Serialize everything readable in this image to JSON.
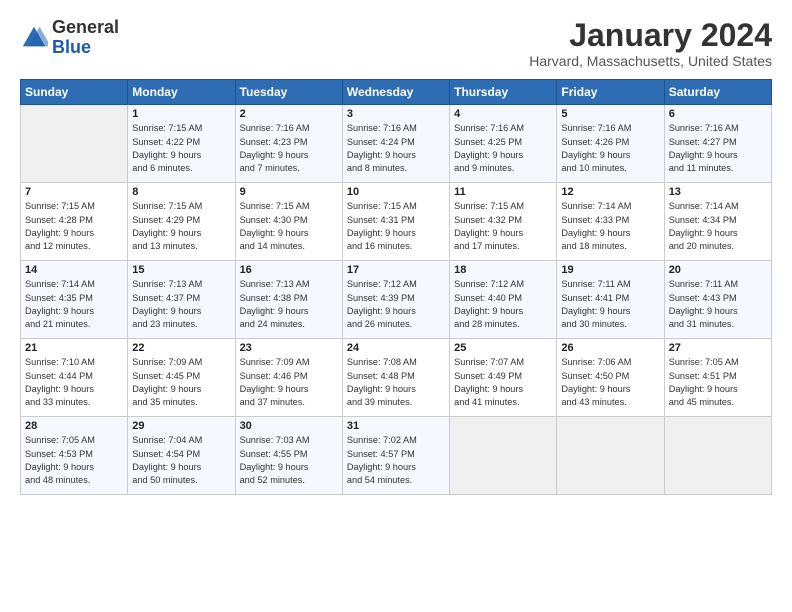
{
  "logo": {
    "line1": "General",
    "line2": "Blue"
  },
  "title": "January 2024",
  "location": "Harvard, Massachusetts, United States",
  "days_header": [
    "Sunday",
    "Monday",
    "Tuesday",
    "Wednesday",
    "Thursday",
    "Friday",
    "Saturday"
  ],
  "weeks": [
    [
      {
        "day": "",
        "info": ""
      },
      {
        "day": "1",
        "info": "Sunrise: 7:15 AM\nSunset: 4:22 PM\nDaylight: 9 hours\nand 6 minutes."
      },
      {
        "day": "2",
        "info": "Sunrise: 7:16 AM\nSunset: 4:23 PM\nDaylight: 9 hours\nand 7 minutes."
      },
      {
        "day": "3",
        "info": "Sunrise: 7:16 AM\nSunset: 4:24 PM\nDaylight: 9 hours\nand 8 minutes."
      },
      {
        "day": "4",
        "info": "Sunrise: 7:16 AM\nSunset: 4:25 PM\nDaylight: 9 hours\nand 9 minutes."
      },
      {
        "day": "5",
        "info": "Sunrise: 7:16 AM\nSunset: 4:26 PM\nDaylight: 9 hours\nand 10 minutes."
      },
      {
        "day": "6",
        "info": "Sunrise: 7:16 AM\nSunset: 4:27 PM\nDaylight: 9 hours\nand 11 minutes."
      }
    ],
    [
      {
        "day": "7",
        "info": "Sunrise: 7:15 AM\nSunset: 4:28 PM\nDaylight: 9 hours\nand 12 minutes."
      },
      {
        "day": "8",
        "info": "Sunrise: 7:15 AM\nSunset: 4:29 PM\nDaylight: 9 hours\nand 13 minutes."
      },
      {
        "day": "9",
        "info": "Sunrise: 7:15 AM\nSunset: 4:30 PM\nDaylight: 9 hours\nand 14 minutes."
      },
      {
        "day": "10",
        "info": "Sunrise: 7:15 AM\nSunset: 4:31 PM\nDaylight: 9 hours\nand 16 minutes."
      },
      {
        "day": "11",
        "info": "Sunrise: 7:15 AM\nSunset: 4:32 PM\nDaylight: 9 hours\nand 17 minutes."
      },
      {
        "day": "12",
        "info": "Sunrise: 7:14 AM\nSunset: 4:33 PM\nDaylight: 9 hours\nand 18 minutes."
      },
      {
        "day": "13",
        "info": "Sunrise: 7:14 AM\nSunset: 4:34 PM\nDaylight: 9 hours\nand 20 minutes."
      }
    ],
    [
      {
        "day": "14",
        "info": "Sunrise: 7:14 AM\nSunset: 4:35 PM\nDaylight: 9 hours\nand 21 minutes."
      },
      {
        "day": "15",
        "info": "Sunrise: 7:13 AM\nSunset: 4:37 PM\nDaylight: 9 hours\nand 23 minutes."
      },
      {
        "day": "16",
        "info": "Sunrise: 7:13 AM\nSunset: 4:38 PM\nDaylight: 9 hours\nand 24 minutes."
      },
      {
        "day": "17",
        "info": "Sunrise: 7:12 AM\nSunset: 4:39 PM\nDaylight: 9 hours\nand 26 minutes."
      },
      {
        "day": "18",
        "info": "Sunrise: 7:12 AM\nSunset: 4:40 PM\nDaylight: 9 hours\nand 28 minutes."
      },
      {
        "day": "19",
        "info": "Sunrise: 7:11 AM\nSunset: 4:41 PM\nDaylight: 9 hours\nand 30 minutes."
      },
      {
        "day": "20",
        "info": "Sunrise: 7:11 AM\nSunset: 4:43 PM\nDaylight: 9 hours\nand 31 minutes."
      }
    ],
    [
      {
        "day": "21",
        "info": "Sunrise: 7:10 AM\nSunset: 4:44 PM\nDaylight: 9 hours\nand 33 minutes."
      },
      {
        "day": "22",
        "info": "Sunrise: 7:09 AM\nSunset: 4:45 PM\nDaylight: 9 hours\nand 35 minutes."
      },
      {
        "day": "23",
        "info": "Sunrise: 7:09 AM\nSunset: 4:46 PM\nDaylight: 9 hours\nand 37 minutes."
      },
      {
        "day": "24",
        "info": "Sunrise: 7:08 AM\nSunset: 4:48 PM\nDaylight: 9 hours\nand 39 minutes."
      },
      {
        "day": "25",
        "info": "Sunrise: 7:07 AM\nSunset: 4:49 PM\nDaylight: 9 hours\nand 41 minutes."
      },
      {
        "day": "26",
        "info": "Sunrise: 7:06 AM\nSunset: 4:50 PM\nDaylight: 9 hours\nand 43 minutes."
      },
      {
        "day": "27",
        "info": "Sunrise: 7:05 AM\nSunset: 4:51 PM\nDaylight: 9 hours\nand 45 minutes."
      }
    ],
    [
      {
        "day": "28",
        "info": "Sunrise: 7:05 AM\nSunset: 4:53 PM\nDaylight: 9 hours\nand 48 minutes."
      },
      {
        "day": "29",
        "info": "Sunrise: 7:04 AM\nSunset: 4:54 PM\nDaylight: 9 hours\nand 50 minutes."
      },
      {
        "day": "30",
        "info": "Sunrise: 7:03 AM\nSunset: 4:55 PM\nDaylight: 9 hours\nand 52 minutes."
      },
      {
        "day": "31",
        "info": "Sunrise: 7:02 AM\nSunset: 4:57 PM\nDaylight: 9 hours\nand 54 minutes."
      },
      {
        "day": "",
        "info": ""
      },
      {
        "day": "",
        "info": ""
      },
      {
        "day": "",
        "info": ""
      }
    ]
  ]
}
